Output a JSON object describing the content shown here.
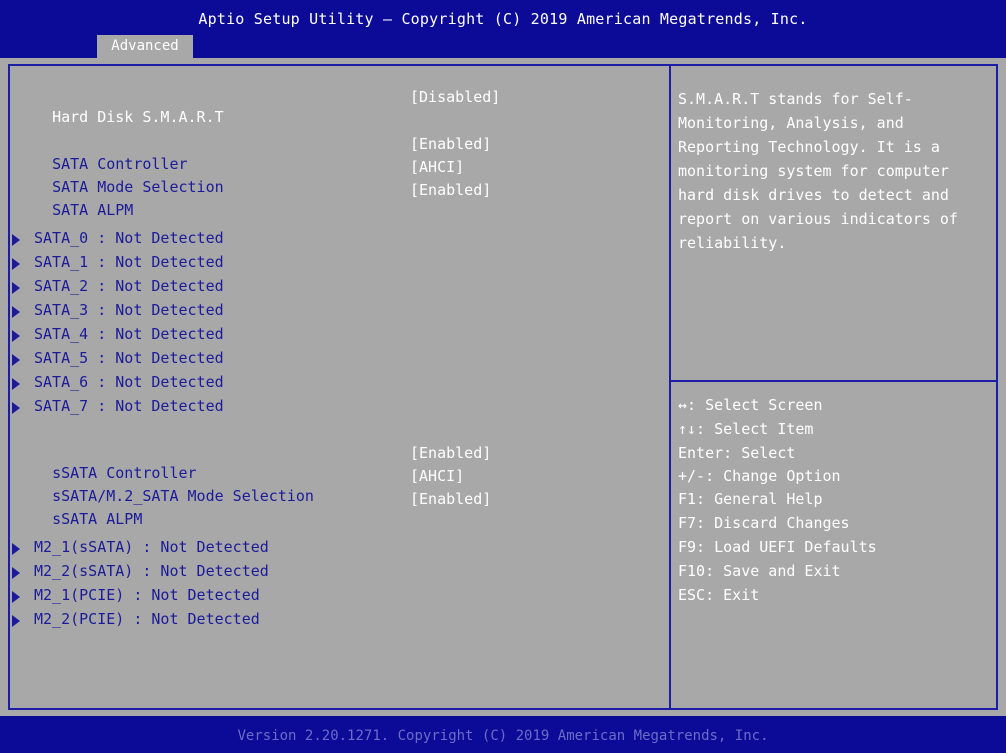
{
  "header": {
    "title": "Aptio Setup Utility – Copyright (C) 2019 American Megatrends, Inc.",
    "tab": "Advanced"
  },
  "settings": [
    {
      "label": "Hard Disk S.M.A.R.T",
      "value": "[Disabled]",
      "selected": true
    },
    {
      "label": "SATA Controller",
      "value": "[Enabled]"
    },
    {
      "label": "SATA Mode Selection",
      "value": "[AHCI]"
    },
    {
      "label": "SATA ALPM",
      "value": "[Enabled]"
    },
    {
      "label": "sSATA Controller",
      "value": "[Enabled]"
    },
    {
      "label": "sSATA/M.2_SATA Mode Selection",
      "value": "[AHCI]"
    },
    {
      "label": "sSATA ALPM",
      "value": "[Enabled]"
    }
  ],
  "submenus": [
    "SATA_0 : Not Detected",
    "SATA_1 : Not Detected",
    "SATA_2 : Not Detected",
    "SATA_3 : Not Detected",
    "SATA_4 : Not Detected",
    "SATA_5 : Not Detected",
    "SATA_6 : Not Detected",
    "SATA_7 : Not Detected",
    "M2_1(sSATA) : Not Detected",
    "M2_2(sSATA) : Not Detected",
    "M2_1(PCIE) : Not Detected",
    "M2_2(PCIE) : Not Detected"
  ],
  "help": {
    "description": "S.M.A.R.T stands for Self-Monitoring, Analysis, and Reporting Technology. It is a monitoring system for computer hard disk drives to detect and report on various indicators of reliability."
  },
  "hotkeys": [
    "↔: Select Screen",
    "↑↓: Select Item",
    "Enter: Select",
    "+/-: Change Option",
    "F1: General Help",
    "F7: Discard Changes",
    "F9: Load UEFI Defaults",
    "F10: Save and Exit",
    "ESC: Exit"
  ],
  "footer": {
    "text": "Version 2.20.1271. Copyright (C) 2019 American Megatrends, Inc."
  },
  "colors": {
    "background": "#a8a8a8",
    "bar_blue": "#0b0b97",
    "label_blue": "#1b1b9a",
    "highlight": "#ffffff"
  }
}
